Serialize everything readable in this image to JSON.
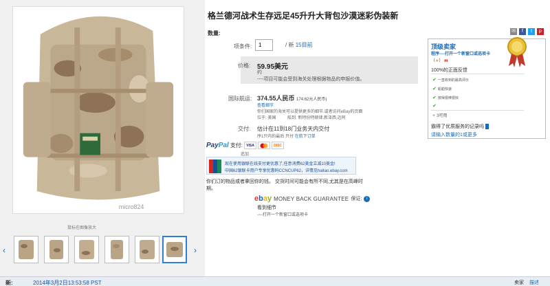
{
  "product": {
    "title": "格兰德河战术生存远足45升升大背包沙漠迷彩伪装新",
    "quantity_section_label": "数量:",
    "quantity_label": "项条件:",
    "quantity_value": "1",
    "quantity_available_prefix": "/ 新",
    "quantity_available_link": "15目前"
  },
  "price": {
    "label": "价格:",
    "value": "59.95美元",
    "approx": "约",
    "note": "----项目可能会受到海关处理根据物品的申报价值。"
  },
  "shipping": {
    "label": "国际航运:",
    "value": "374.55人民币",
    "approx": "174.62元人民币)",
    "line1": "查看细节",
    "line2": "你们国家的海关可以提供更多的细节.或者访问eBay的页面",
    "line3": "位于: 美国",
    "line4": "船到: 新特份特顿律,新泽西,迈阿"
  },
  "delivery": {
    "label": "交付:",
    "value": "估计在11到18门业务天内交付",
    "sub_prefix": "序1只内的最后 只付",
    "sub_link": "在航下订单"
  },
  "payment": {
    "paypal_a": "Pay",
    "paypal_b": "Pal",
    "suffix": "支付:",
    "cards": [
      "VISA",
      "MC",
      "DISC"
    ],
    "more": "追加"
  },
  "unionpay": {
    "line1": "现在使用银联在线支付更优惠了,任意消费62美金立减10美金!",
    "line2": "中国62银联卡用户专享优惠码CCNCUP62，详情见haitao.ebay.com"
  },
  "customs_note": "你们订的物品或者拿回你的钱。 交货时间可能会有所不同,尤其是在高峰时期。",
  "guarantee": {
    "logo_e": "e",
    "logo_b": "b",
    "logo_a": "a",
    "logo_y": "y",
    "text": "MONEY BACK GUARANTEE",
    "word": "保证:",
    "link": "看到细节",
    "sub": "----打开一个新窗口或选项卡"
  },
  "seller": {
    "title": "顶级卖家",
    "link": "程序----打开一个新窗口或选项卡",
    "score_open": "（",
    "score_star": "★",
    "score_close": "）",
    "score_me": "m",
    "pct": "100%的正面反馈",
    "items": [
      "一直收到的最高评价",
      "船舶快速",
      "按得很棒很快"
    ],
    "count": "3可用",
    "follow": "霸得了优质服务的记录吗",
    "more": "请输入数量的1或更多"
  },
  "images": {
    "zoom_label": "鼠标在图像放大",
    "watermark": "micro824"
  },
  "bottom": {
    "new_label": "新:",
    "date": "2014年3月2日13:53:58 PST",
    "right1": "卖家",
    "right2": "描述"
  },
  "colors": {
    "link": "#1a6bb5",
    "price_bg": "#e8e8e8",
    "bottom_bg": "#e8edf4"
  }
}
